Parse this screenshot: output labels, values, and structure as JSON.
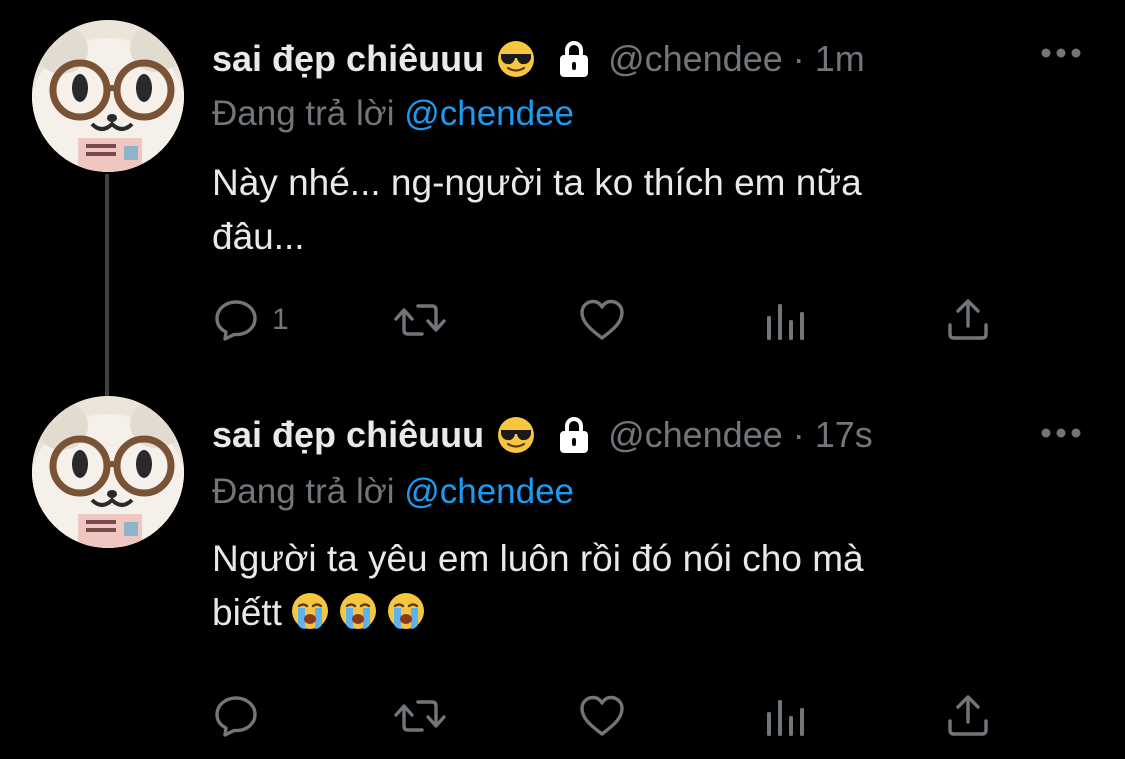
{
  "tweets": [
    {
      "display_name": "sai đẹp chiêuuu",
      "name_emoji": "smiling-face-with-sunglasses",
      "protected": true,
      "handle": "@chendee",
      "separator": "·",
      "time": "1m",
      "replying_prefix": "Đang trả lời",
      "replying_to": "@chendee",
      "text_lines": [
        "Này nhé... ng-người ta ko thích em nữa",
        "đâu..."
      ],
      "trailing_emojis": [],
      "reply_count": "1",
      "has_thread_line": true
    },
    {
      "display_name": "sai đẹp chiêuuu",
      "name_emoji": "smiling-face-with-sunglasses",
      "protected": true,
      "handle": "@chendee",
      "separator": "·",
      "time": "17s",
      "replying_prefix": "Đang trả lời",
      "replying_to": "@chendee",
      "text_lines": [
        "Người ta yêu em luôn rồi đó nói cho mà",
        "biếtt"
      ],
      "trailing_emojis": [
        "loudly-crying-face",
        "loudly-crying-face",
        "loudly-crying-face"
      ],
      "reply_count": "",
      "has_thread_line": false
    }
  ],
  "icons": {
    "more": "more-horizontal-icon",
    "reply": "reply-bubble-icon",
    "retweet": "retweet-icon",
    "like": "heart-icon",
    "views": "views-bar-chart-icon",
    "share": "share-upload-icon",
    "lock": "lock-icon"
  },
  "colors": {
    "background": "#000000",
    "text_primary": "#e7e9ea",
    "text_secondary": "#71767b",
    "link_blue": "#1d9bf0",
    "thread_line": "#3e4144"
  }
}
